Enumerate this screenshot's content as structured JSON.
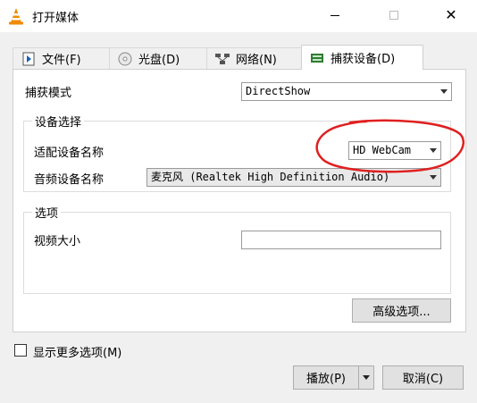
{
  "window": {
    "title": "打开媒体"
  },
  "tabs": [
    {
      "label": "文件(F)",
      "icon": "file-icon",
      "active": false
    },
    {
      "label": "光盘(D)",
      "icon": "disc-icon",
      "active": false
    },
    {
      "label": "网络(N)",
      "icon": "network-icon",
      "active": false
    },
    {
      "label": "捕获设备(D)",
      "icon": "capture-device-icon",
      "active": true
    }
  ],
  "capture": {
    "mode_label": "捕获模式",
    "mode_value": "DirectShow"
  },
  "device_group": {
    "title": "设备选择",
    "video_label": "适配设备名称",
    "video_value": "HD WebCam",
    "audio_label": "音频设备名称",
    "audio_value": "麦克风 (Realtek High Definition Audio)"
  },
  "options_group": {
    "title": "选项",
    "video_size_label": "视频大小",
    "video_size_value": ""
  },
  "advanced_button": "高级选项...",
  "show_more": {
    "label": "显示更多选项(M)",
    "checked": false
  },
  "buttons": {
    "play": "播放(P)",
    "cancel": "取消(C)"
  },
  "colors": {
    "annotation": "#e02020",
    "vlc_orange": "#f08a00"
  }
}
